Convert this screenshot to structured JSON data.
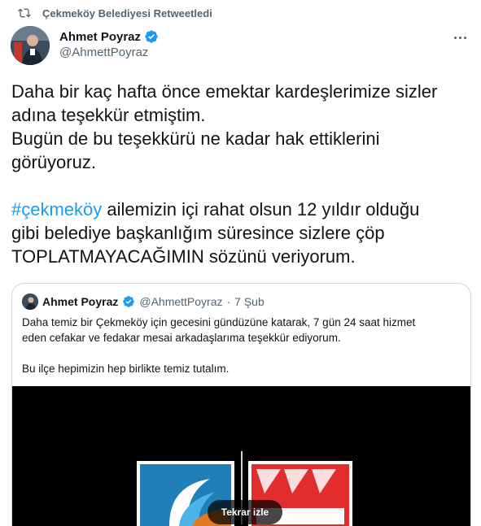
{
  "retweet": {
    "label": "Çekmeköy Belediyesi Retweetledi"
  },
  "author": {
    "name": "Ahmet Poyraz",
    "handle": "@AhmettPoyraz"
  },
  "tweet": {
    "line1": "Daha bir kaç hafta önce emektar kardeşlerimize sizler",
    "line2": "adına teşekkür etmiştim.",
    "line3": "Bugün de bu teşekkürü ne kadar hak ettiklerini",
    "line4": "görüyoruz.",
    "hashtag": "#çekmeköy",
    "line5_rest": " ailemizin içi rahat olsun 12 yıldır olduğu",
    "line6": "gibi belediye başkanlığım süresince sizlere çöp",
    "line7": "TOPLATMAYACAĞIMIN sözünü veriyorum."
  },
  "quote": {
    "name": "Ahmet Poyraz",
    "handle": "@AhmettPoyraz",
    "dot": "·",
    "date": "7 Şub",
    "line1": "Daha temiz bir Çekmeköy için gecesini gündüzüne katarak, 7 gün 24 saat hizmet",
    "line2": "eden cefakar ve fedakar mesai arkadaşlarıma teşekkür ediyorum.",
    "line3": "Bu ilçe hepimizin hep birlikte temiz tutalım."
  },
  "media": {
    "replay_label": "Tekrar izle"
  },
  "colors": {
    "accent": "#1d9bf0",
    "secondary_text": "#536471",
    "border": "#cfd9de"
  }
}
